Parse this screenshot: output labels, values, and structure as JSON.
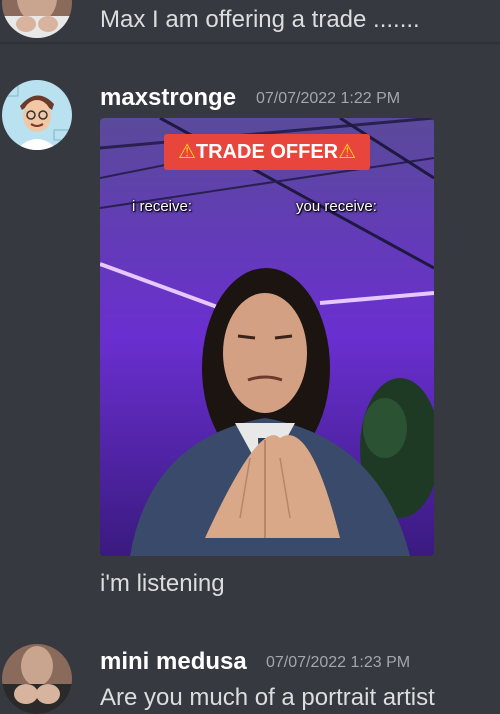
{
  "messages": [
    {
      "text": "Max I am offering a trade ......."
    },
    {
      "username": "maxstronge",
      "timestamp": "07/07/2022 1:22 PM",
      "meme": {
        "banner_text": "TRADE OFFER",
        "warning_icon": "⚠",
        "label_left": "i receive:",
        "label_right": "you receive:"
      },
      "text": "i'm listening"
    },
    {
      "username": "mini medusa",
      "timestamp": "07/07/2022 1:23 PM",
      "text": "Are you much of a portrait artist"
    }
  ],
  "colors": {
    "background": "#36393f",
    "text": "#dcddde",
    "username": "#ffffff",
    "timestamp": "#a3a6aa",
    "banner": "#e8453c"
  }
}
